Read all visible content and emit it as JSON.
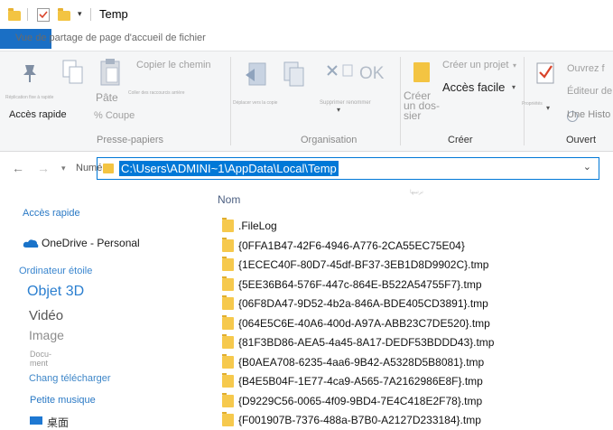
{
  "window": {
    "title": "Temp"
  },
  "ribbon_tabs": {
    "file_tab": "",
    "tabs_text": "Vue de partage de page d'accueil de fichier"
  },
  "ribbon": {
    "clipboard": {
      "pin_label": "Accès rapide",
      "pin_tiny": "Réplication fixe à rapide",
      "paste_label": "Pâte",
      "copy_path": "Copier le chemin",
      "paste_shortcut": "Coller des raccourcis arrière",
      "cut": "% Coupe",
      "group": "Presse-papiers"
    },
    "organize": {
      "move_tiny": "Déplacer vers la copie",
      "delete_tiny": "Supprimer renommer",
      "ok": "OK",
      "group": "Organisation"
    },
    "new": {
      "new_folder_line1": "Créer",
      "new_folder_line2": "un dos-",
      "new_folder_line3": "sier",
      "new_item": "Créer un projet",
      "easy_access": "Accès facile",
      "group": "Créer"
    },
    "open": {
      "properties_tiny": "Propriétés",
      "open_menu": "Ouvrez f",
      "edit": "Éditeur de",
      "history": "Une Histo",
      "group": "Ouvert"
    }
  },
  "address": {
    "prefix": "Numéro",
    "path": "C:\\Users\\ADMINI~1\\AppData\\Local\\Temp"
  },
  "navpane": {
    "quick_access": "Accès rapide",
    "onedrive": "OneDrive - Personal",
    "this_pc": "Ordinateur étoile",
    "objects3d": "Objet 3D",
    "videos": "Vidéo",
    "pictures": "Image",
    "documents": "Docu-\nment",
    "downloads": "Chang télécharger",
    "music": "Petite musique",
    "desktop": "桌面"
  },
  "filelist": {
    "header_name": "Nom",
    "header_ghost": "ترتيبها",
    "rows": [
      ".FileLog",
      "{0FFA1B47-42F6-4946-A776-2CA55EC75E04}",
      "{1ECEC40F-80D7-45df-BF37-3EB1D8D9902C}.tmp",
      "{5EE36B64-576F-447c-864E-B522A54755F7}.tmp",
      "{06F8DA47-9D52-4b2a-846A-BDE405CD3891}.tmp",
      "{064E5C6E-40A6-400d-A97A-ABB23C7DE520}.tmp",
      "{81F3BD86-AEA5-4a45-8A17-DEDF53BDDD43}.tmp",
      "{B0AEA708-6235-4aa6-9B42-A5328D5B8081}.tmp",
      "{B4E5B04F-1E77-4ca9-A565-7A2162986E8F}.tmp",
      "{D9229C56-0065-4f09-9BD4-7E4C418E2F78}.tmp",
      "{F001907B-7376-488a-B7B0-A2127D233184}.tmp"
    ]
  },
  "colors": {
    "accent": "#0078d7",
    "file_tab": "#1a6fc5",
    "folder": "#f6c94d"
  },
  "icons": {
    "qat": [
      "folder-icon",
      "properties-check-icon",
      "new-folder-icon",
      "customize-dropdown-icon"
    ],
    "ribbon": [
      "pin-icon",
      "copy-icon",
      "paste-icon",
      "move-to-icon",
      "copy-to-icon",
      "delete-icon",
      "rename-icon",
      "new-folder-icon",
      "properties-icon"
    ]
  }
}
